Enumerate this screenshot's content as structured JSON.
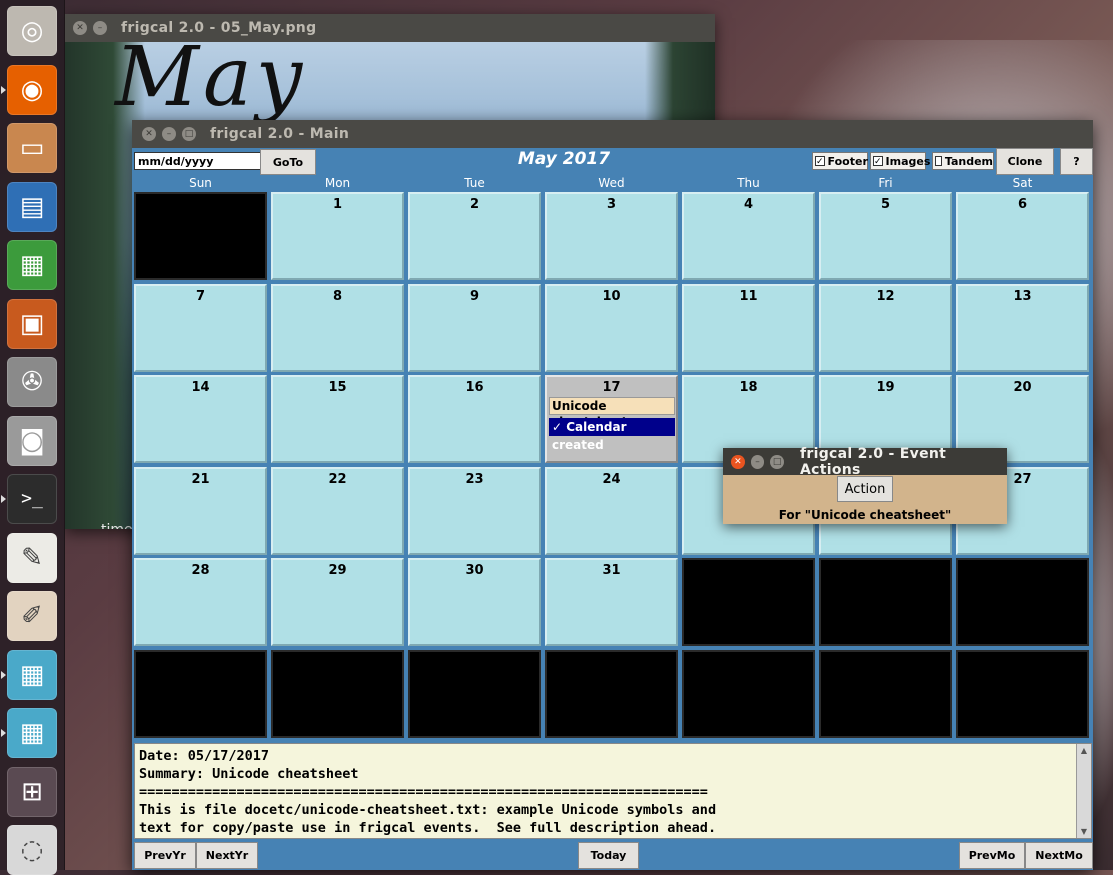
{
  "launcher": {
    "items": [
      {
        "name": "dash-home",
        "glyph": "◎",
        "bg": "#bdb8b0"
      },
      {
        "name": "firefox",
        "glyph": "◉",
        "bg": "#e66000"
      },
      {
        "name": "files",
        "glyph": "▭",
        "bg": "#c9874f"
      },
      {
        "name": "libreoffice-writer",
        "glyph": "▤",
        "bg": "#2f6fb5"
      },
      {
        "name": "libreoffice-calc",
        "glyph": "▦",
        "bg": "#3c9b3c"
      },
      {
        "name": "libreoffice-impress",
        "glyph": "▣",
        "bg": "#c85a1e"
      },
      {
        "name": "system-settings",
        "glyph": "✇",
        "bg": "#8a8a8a"
      },
      {
        "name": "camera",
        "glyph": "◙",
        "bg": "#9a9a9a"
      },
      {
        "name": "terminal",
        "glyph": ">_",
        "bg": "#2c2c2c"
      },
      {
        "name": "text-editor",
        "glyph": "✎",
        "bg": "#ecebe6"
      },
      {
        "name": "drawing",
        "glyph": "✐",
        "bg": "#e2d3c0"
      },
      {
        "name": "frigcal-1",
        "glyph": "▦",
        "bg": "#4aa9c9"
      },
      {
        "name": "frigcal-2",
        "glyph": "▦",
        "bg": "#4aa9c9"
      },
      {
        "name": "workspaces",
        "glyph": "⊞",
        "bg": "#5a4a52"
      },
      {
        "name": "trash",
        "glyph": "◌",
        "bg": "#d8d8d8"
      }
    ]
  },
  "image_window": {
    "title": "frigcal 2.0 - 05_May.png",
    "image_text": "May",
    "caption": "time"
  },
  "main_window": {
    "title": "frigcal 2.0 - Main",
    "date_placeholder": "mm/dd/yyyy",
    "goto_label": "GoTo",
    "month_title": "May 2017",
    "footer_label": "Footer",
    "images_label": "Images",
    "tandem_label": "Tandem",
    "clone_label": "Clone",
    "help_label": "?",
    "days_of_week": [
      "Sun",
      "Mon",
      "Tue",
      "Wed",
      "Thu",
      "Fri",
      "Sat"
    ],
    "weeks": [
      [
        "",
        "1",
        "2",
        "3",
        "4",
        "5",
        "6"
      ],
      [
        "7",
        "8",
        "9",
        "10",
        "11",
        "12",
        "13"
      ],
      [
        "14",
        "15",
        "16",
        "17",
        "18",
        "19",
        "20"
      ],
      [
        "21",
        "22",
        "23",
        "24",
        "25",
        "26",
        "27"
      ],
      [
        "28",
        "29",
        "30",
        "31",
        "",
        "",
        ""
      ],
      [
        "",
        "",
        "",
        "",
        "",
        "",
        ""
      ]
    ],
    "events": {
      "day17_event1": "Unicode cheatsheet",
      "day17_event2": "✓ Calendar created"
    },
    "footer_lines": [
      "Date: 05/17/2017",
      "Summary: Unicode cheatsheet",
      "======================================================================",
      "This is file docetc/unicode-cheatsheet.txt: example Unicode symbols and",
      "text for copy/paste use in frigcal events.  See full description ahead."
    ],
    "prevyr_label": "PrevYr",
    "nextyr_label": "NextYr",
    "today_label": "Today",
    "prevmo_label": "PrevMo",
    "nextmo_label": "NextMo"
  },
  "dialog": {
    "title": "frigcal 2.0 - Event Actions",
    "action_label": "Action",
    "for_text": "For \"Unicode cheatsheet\""
  },
  "colors": {
    "accent_blue": "#4682b4",
    "day_cell": "#b0e0e6",
    "event_bg": "#f6e0b9",
    "event_selected": "#00008b",
    "footer_bg": "#f5f5dc",
    "dialog_bg": "#d2b48c"
  }
}
